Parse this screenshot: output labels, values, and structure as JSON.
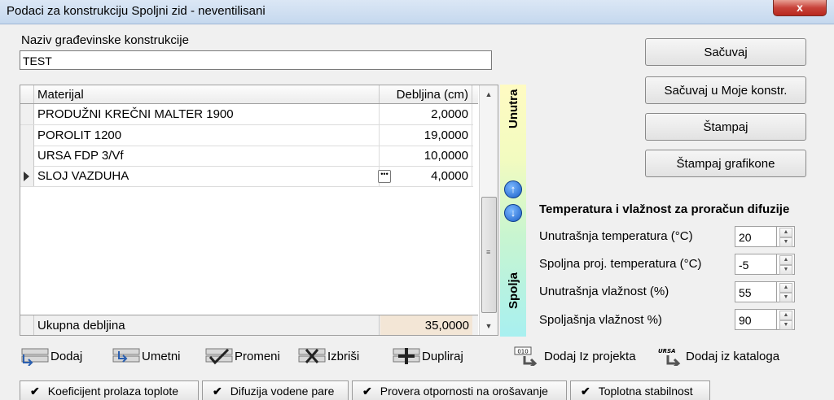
{
  "window": {
    "title": "Podaci za konstrukciju Spoljni zid - neventilisani",
    "close_label": "x"
  },
  "construction": {
    "label": "Naziv građevinske konstrukcije",
    "value": "TEST"
  },
  "grid": {
    "col_material": "Materijal",
    "col_thickness": "Debljina (cm)",
    "rows": [
      {
        "material": "PRODUŽNI KREČNI MALTER 1900",
        "thickness": "2,0000"
      },
      {
        "material": "POROLIT 1200",
        "thickness": "19,0000"
      },
      {
        "material": "URSA FDP 3/Vf",
        "thickness": "10,0000"
      },
      {
        "material": "SLOJ VAZDUHA",
        "thickness": "4,0000"
      }
    ],
    "total_label": "Ukupna debljina",
    "total_value": "35,0000"
  },
  "side": {
    "inside": "Unutra",
    "outside": "Spolja"
  },
  "buttons": {
    "save": "Sačuvaj",
    "save_mine": "Sačuvaj u Moje konstr.",
    "print": "Štampaj",
    "print_charts": "Štampaj grafikone"
  },
  "diffusion": {
    "title": "Temperatura i vlažnost za proračun difuzije",
    "inner_temp_label": "Unutrašnja  temperatura (°C)",
    "inner_temp": "20",
    "outer_temp_label": "Spoljna proj.  temperatura (°C)",
    "outer_temp": "-5",
    "inner_hum_label": "Unutrašnja vlažnost (%)",
    "inner_hum": "55",
    "outer_hum_label": "Spoljašnja vlažnost %)",
    "outer_hum": "90"
  },
  "toolbar": {
    "add": "Dodaj",
    "insert": "Umetni",
    "change": "Promeni",
    "delete": "Izbriši",
    "duplicate": "Dupliraj",
    "add_project": "Dodaj Iz projekta",
    "add_catalog": "Dodaj  iz kataloga",
    "project_badge": "010",
    "catalog_badge": "URSA"
  },
  "tabs": [
    "Koeficijent prolaza toplote",
    "Difuzija vodene pare",
    "Provera otpornosti na orošavanje",
    "Toplotna stabilnost"
  ]
}
